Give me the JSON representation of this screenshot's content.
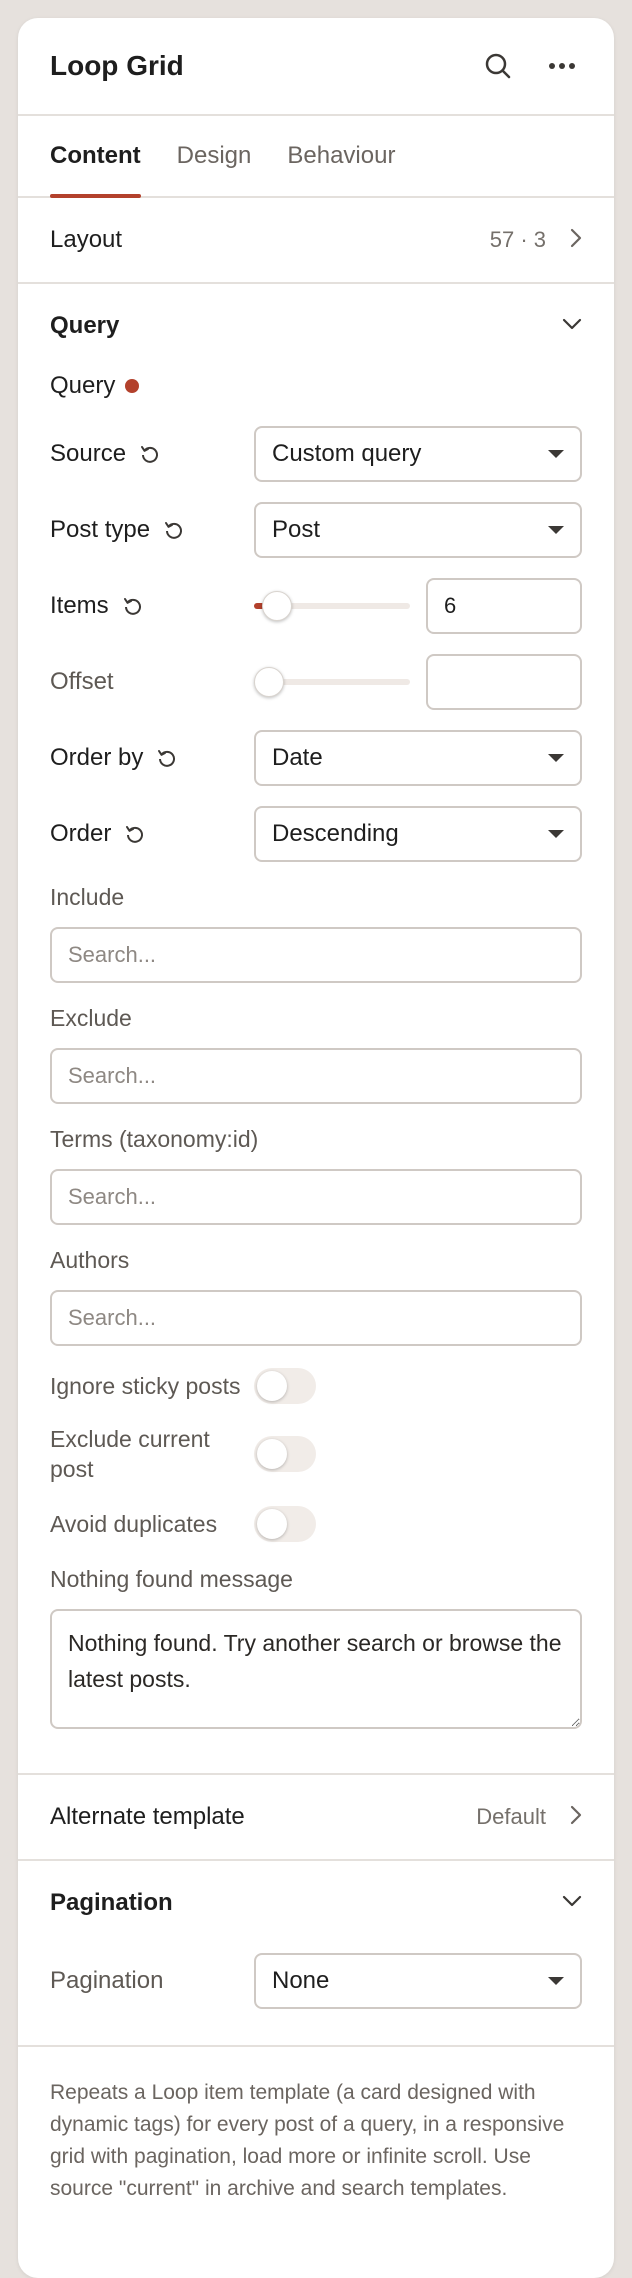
{
  "header": {
    "title": "Loop Grid"
  },
  "tabs": [
    {
      "label": "Content",
      "active": true
    },
    {
      "label": "Design",
      "active": false
    },
    {
      "label": "Behaviour",
      "active": false
    }
  ],
  "layout": {
    "label": "Layout",
    "value": "57 · 3"
  },
  "query_section": {
    "title": "Query",
    "subtitle": "Query",
    "indicator_color": "#b3412c",
    "source": {
      "label": "Source",
      "value": "Custom query"
    },
    "post_type": {
      "label": "Post type",
      "value": "Post"
    },
    "items": {
      "label": "Items",
      "value": "6",
      "slider_fraction": 0.06
    },
    "offset": {
      "label": "Offset",
      "value": "",
      "slider_fraction": 0
    },
    "order_by": {
      "label": "Order by",
      "value": "Date"
    },
    "order": {
      "label": "Order",
      "value": "Descending"
    },
    "include": {
      "label": "Include",
      "placeholder": "Search..."
    },
    "exclude": {
      "label": "Exclude",
      "placeholder": "Search..."
    },
    "terms": {
      "label": "Terms (taxonomy:id)",
      "placeholder": "Search..."
    },
    "authors": {
      "label": "Authors",
      "placeholder": "Search..."
    },
    "ignore_sticky": {
      "label": "Ignore sticky posts",
      "on": false
    },
    "exclude_current": {
      "label": "Exclude current post",
      "on": false
    },
    "avoid_duplicates": {
      "label": "Avoid duplicates",
      "on": false
    },
    "nothing_found": {
      "label": "Nothing found message",
      "value": "Nothing found. Try another search or browse the latest posts."
    }
  },
  "alternate_template": {
    "label": "Alternate template",
    "value": "Default"
  },
  "pagination_section": {
    "title": "Pagination",
    "pagination": {
      "label": "Pagination",
      "value": "None"
    }
  },
  "footer": {
    "description": "Repeats a Loop item template (a card designed with dynamic tags) for every post of a query, in a responsive grid with pagination, load more or infinite scroll. Use source \"current\" in archive and search templates."
  },
  "colors": {
    "accent": "#b3412c",
    "background": "#e6e1dd",
    "panel": "#ffffff"
  }
}
